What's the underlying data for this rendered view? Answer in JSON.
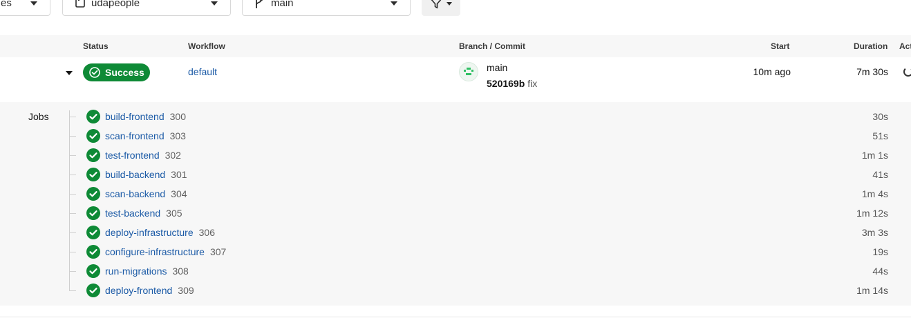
{
  "filters": {
    "status_value": "es",
    "project_value": "udapeople",
    "branch_value": "main"
  },
  "table": {
    "headers": {
      "status": "Status",
      "workflow": "Workflow",
      "branch": "Branch / Commit",
      "start": "Start",
      "duration": "Duration",
      "actions": "Act"
    }
  },
  "pipeline": {
    "status": "Success",
    "workflow": "default",
    "branch": "main",
    "commit_hash": "520169b",
    "commit_message": "fix",
    "start": "10m ago",
    "duration": "7m 30s"
  },
  "jobs": {
    "label": "Jobs",
    "items": [
      {
        "name": "build-frontend",
        "number": "300",
        "duration": "30s"
      },
      {
        "name": "scan-frontend",
        "number": "303",
        "duration": "51s"
      },
      {
        "name": "test-frontend",
        "number": "302",
        "duration": "1m 1s"
      },
      {
        "name": "build-backend",
        "number": "301",
        "duration": "41s"
      },
      {
        "name": "scan-backend",
        "number": "304",
        "duration": "1m 4s"
      },
      {
        "name": "test-backend",
        "number": "305",
        "duration": "1m 12s"
      },
      {
        "name": "deploy-infrastructure",
        "number": "306",
        "duration": "3m 3s"
      },
      {
        "name": "configure-infrastructure",
        "number": "307",
        "duration": "19s"
      },
      {
        "name": "run-migrations",
        "number": "308",
        "duration": "44s"
      },
      {
        "name": "deploy-frontend",
        "number": "309",
        "duration": "1m 14s"
      }
    ]
  },
  "colors": {
    "success": "#0e8a36",
    "link": "#1b5aa6"
  },
  "icons": {
    "project": "repo-icon",
    "branch": "branch-icon",
    "filter": "filter-icon",
    "success": "check-circle-icon",
    "action": "rerun-icon"
  }
}
